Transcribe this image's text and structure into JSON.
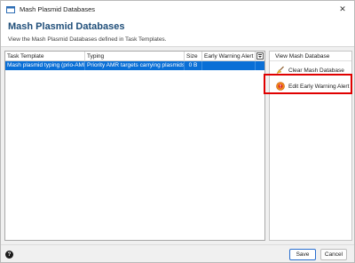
{
  "window": {
    "title": "Mash Plasmid Databases",
    "close_glyph": "✕"
  },
  "header": {
    "title": "Mash Plasmid Databases",
    "subtitle": "View the Mash Plasmid Databases defined in Task Templates."
  },
  "table": {
    "columns": [
      "Task Template",
      "Typing",
      "Size",
      "Early Warning Alert"
    ],
    "rows": [
      {
        "task_template": "Mash plasmid typing (prio-AMR)",
        "typing": "Priority AMR targets carrying plasmids",
        "size": "0 B",
        "early_warning_alert": ""
      }
    ],
    "selected_row_color": "#0a6fd6"
  },
  "side_panel": {
    "header": "View Mash Database",
    "items": [
      {
        "label": "Clear Mash Database",
        "icon": "broom-icon"
      },
      {
        "label": "Edit Early Warning Alert",
        "icon": "alert-icon"
      }
    ],
    "highlight_color": "#e00000"
  },
  "footer": {
    "help_glyph": "?",
    "save_label": "Save",
    "cancel_label": "Cancel"
  }
}
